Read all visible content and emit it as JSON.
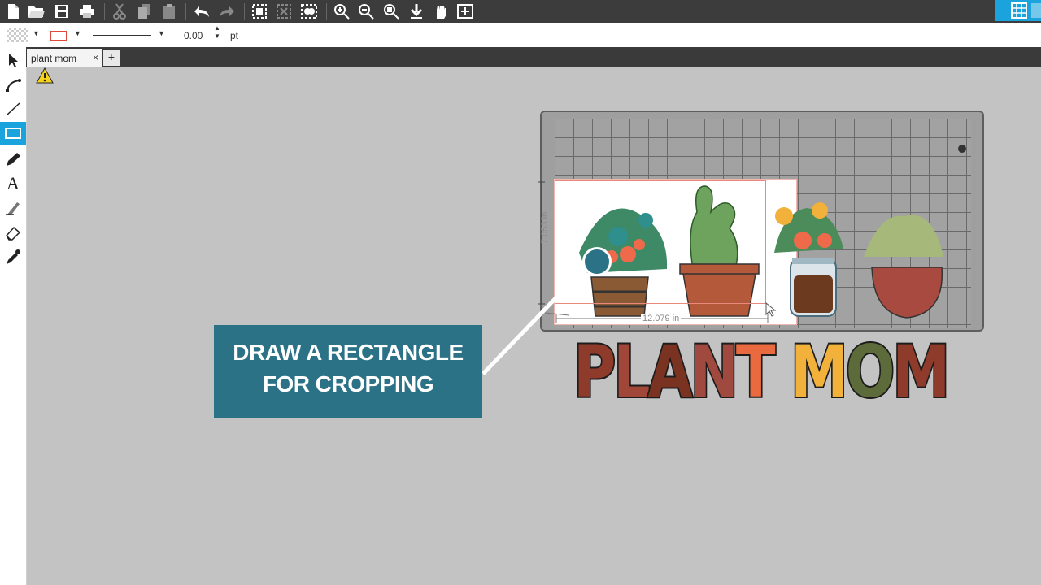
{
  "document": {
    "tab_label": "plant mom",
    "tab_close": "×",
    "add_tab": "+"
  },
  "properties": {
    "stroke_width_value": "0.00",
    "stroke_unit": "pt"
  },
  "toolbar": {
    "icons": [
      "new-file-icon",
      "open-folder-icon",
      "save-icon",
      "print-icon",
      "cut-icon",
      "copy-icon",
      "paste-icon",
      "undo-icon",
      "redo-icon",
      "group-icon",
      "ungroup-icon",
      "weld-icon",
      "zoom-in-icon",
      "zoom-out-icon",
      "zoom-fit-icon",
      "move-down-icon",
      "pan-hand-icon",
      "add-page-icon"
    ],
    "panel_icon": "grid-panel-icon"
  },
  "tools": [
    "select-tool",
    "edit-points-tool",
    "line-tool",
    "rectangle-tool",
    "pencil-tool",
    "text-tool",
    "knife-tool",
    "eraser-tool",
    "eyedropper-tool"
  ],
  "canvas": {
    "dimension_height": "7.053 in",
    "dimension_width": "12.079 in",
    "title_art": "PLANT MOM",
    "title_colors": [
      "#8f3b2c",
      "#a1473a",
      "#7a3321",
      "#a04a3f",
      "#e86a3e",
      "#f2b13a",
      "#5d6b3a",
      "#8f3b2c"
    ]
  },
  "callout": {
    "line1": "DRAW A RECTANGLE",
    "line2": "FOR CROPPING",
    "color": "#2b7286"
  },
  "colors": {
    "accent": "#1aa3dd",
    "crop_outline": "#e9897e",
    "toolbar_bg": "#3c3c3c"
  }
}
